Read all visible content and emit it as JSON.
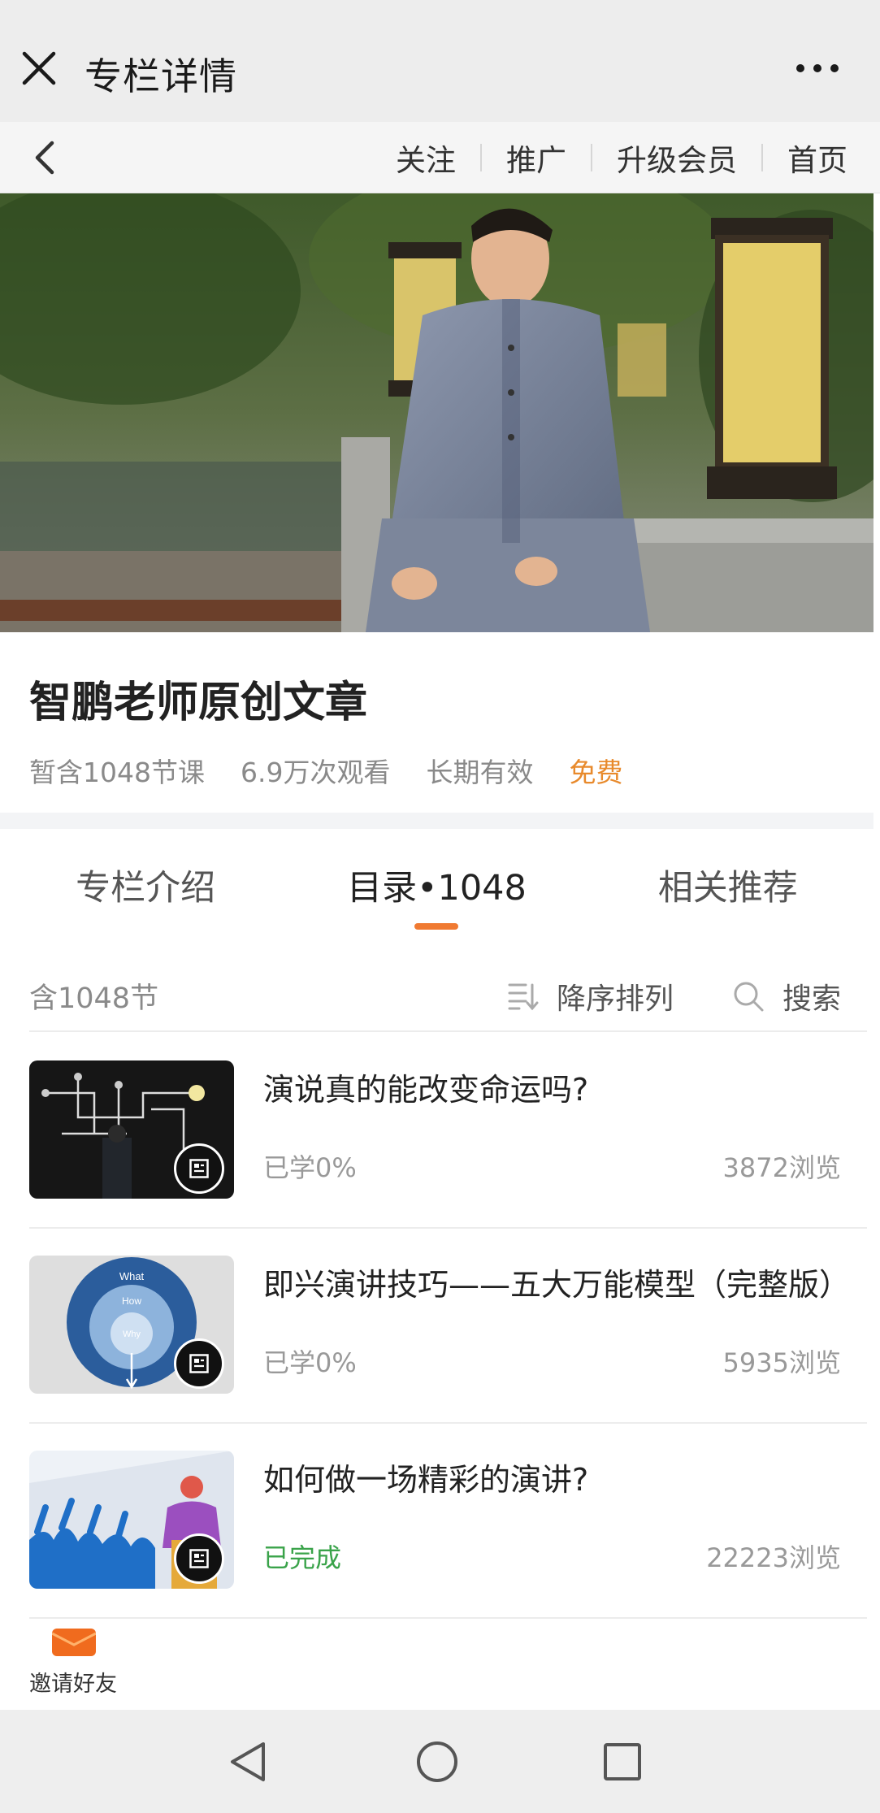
{
  "appbar": {
    "title": "专栏详情"
  },
  "subnav": {
    "links": [
      "关注",
      "推广",
      "升级会员",
      "首页"
    ]
  },
  "column": {
    "name": "智鹏老师原创文章",
    "lessons": "暂含1048节课",
    "views": "6.9万次观看",
    "validity": "长期有效",
    "price": "免费"
  },
  "tabs": [
    "专栏介绍",
    "目录•1048",
    "相关推荐"
  ],
  "list": {
    "count": "含1048节",
    "sort_label": "降序排列",
    "search_label": "搜索",
    "items": [
      {
        "title": "演说真的能改变命运吗?",
        "progress": "已学0%",
        "views": "3872浏览"
      },
      {
        "title": "即兴演讲技巧——五大万能模型（完整版）",
        "progress": "已学0%",
        "views": "5935浏览"
      },
      {
        "title": "如何做一场精彩的演讲?",
        "progress": "已完成",
        "views": "22223浏览"
      }
    ]
  },
  "invite": {
    "label": "邀请好友"
  },
  "colors": {
    "accent": "#f07a32",
    "price": "#e88a2c",
    "done": "#3aa34a"
  }
}
